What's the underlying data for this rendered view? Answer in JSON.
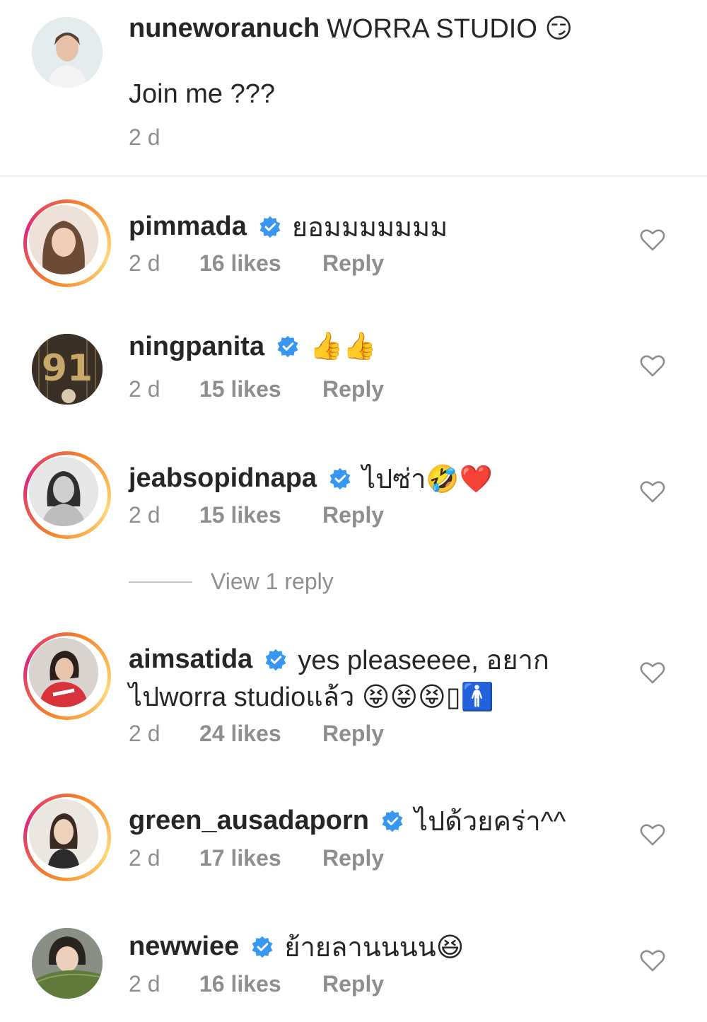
{
  "caption": {
    "username": "nuneworanuch",
    "text_line1": "WORRA STUDIO 😏",
    "text_line2": "Join me ???",
    "time": "2 d"
  },
  "comments": [
    {
      "username": "pimmada",
      "text": "ยอมมมมมมม",
      "time": "2 d",
      "likes": "16 likes",
      "reply": "Reply"
    },
    {
      "username": "ningpanita",
      "text": "👍👍",
      "time": "2 d",
      "likes": "15 likes",
      "reply": "Reply"
    },
    {
      "username": "jeabsopidnapa",
      "text": "ไปซ่า🤣❤️",
      "time": "2 d",
      "likes": "15 likes",
      "reply": "Reply",
      "view_replies": "View 1 reply"
    },
    {
      "username": "aimsatida",
      "text_line1": "yes pleaseeee, อยาก",
      "text_line2": "ไปworra studioแล้ว 😝😝😝▯🚹",
      "time": "2 d",
      "likes": "24 likes",
      "reply": "Reply"
    },
    {
      "username": "green_ausadaporn",
      "text": "ไปด้วยคร่า^^",
      "time": "2 d",
      "likes": "17 likes",
      "reply": "Reply"
    },
    {
      "username": "newwiee",
      "text": "ย้ายลานนนน😆",
      "time": "2 d",
      "likes": "16 likes",
      "reply": "Reply"
    }
  ],
  "colors": {
    "verified": "#3897f0",
    "meta": "#8e8e8e",
    "text": "#262626"
  },
  "icons": {
    "verified": "verified-badge-icon",
    "like": "heart-outline-icon"
  }
}
